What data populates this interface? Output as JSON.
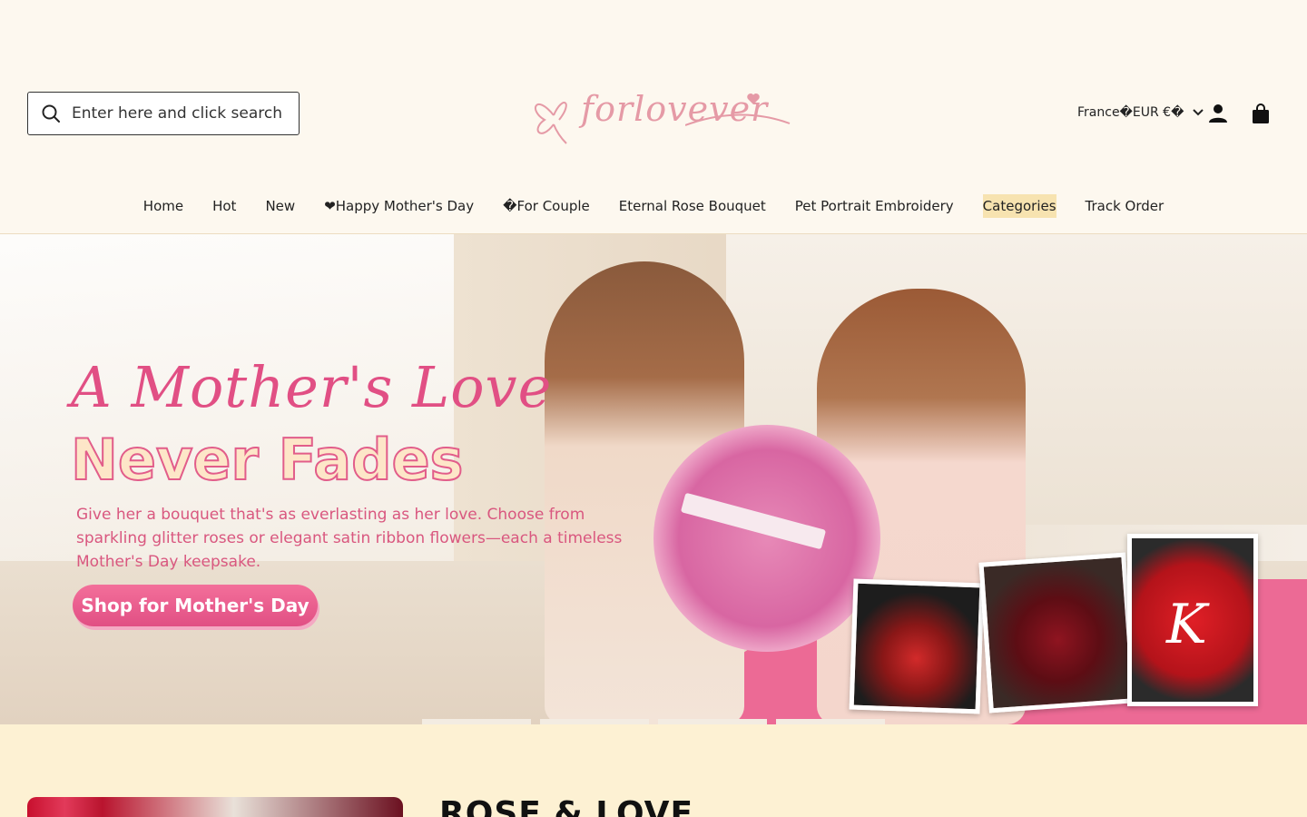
{
  "header": {
    "search_placeholder": "Enter here and click search",
    "logo_text": "forlovever",
    "locale_label": "France�EUR €�",
    "icons": [
      "search-icon",
      "chevron-down-icon",
      "account-icon",
      "shopping-bag-icon"
    ]
  },
  "nav": {
    "items": [
      "Home",
      "Hot",
      "New",
      "❤Happy Mother's Day",
      "�For Couple",
      "Eternal Rose Bouquet",
      "Pet Portrait Embroidery",
      "Categories",
      "Track Order"
    ]
  },
  "hero": {
    "heading_script": "A Mother's Love",
    "heading_bold": "Never Fades",
    "description": "Give her a bouquet that's as everlasting as her love. Choose from sparkling glitter roses or elegant satin ribbon flowers—each a timeless Mother's Day keepsake.",
    "cta_label": "Shop for Mother's Day",
    "card_initial": "K",
    "slides": 4
  },
  "section": {
    "title": "ROSE & LOVE"
  },
  "colors": {
    "background": "#fdf8ef",
    "accent_pink": "#e14f84",
    "highlight": "#f7e3b0"
  }
}
